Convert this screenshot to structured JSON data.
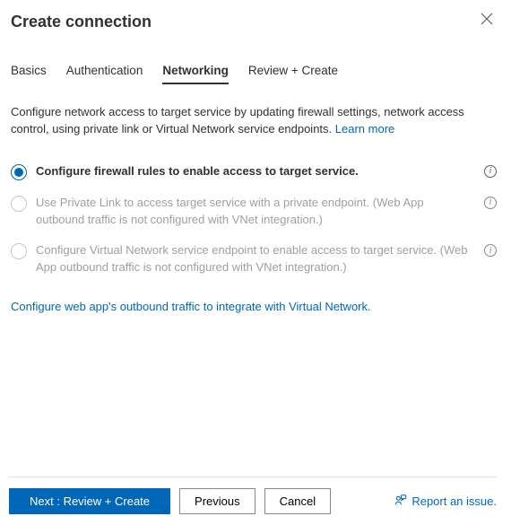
{
  "header": {
    "title": "Create connection"
  },
  "tabs": [
    {
      "label": "Basics",
      "active": false
    },
    {
      "label": "Authentication",
      "active": false
    },
    {
      "label": "Networking",
      "active": true
    },
    {
      "label": "Review + Create",
      "active": false
    }
  ],
  "description": {
    "text": "Configure network access to target service by updating firewall settings, network access control, using private link or Virtual Network service endpoints.",
    "learn_more": "Learn more"
  },
  "options": [
    {
      "label": "Configure firewall rules to enable access to target service.",
      "selected": true,
      "disabled": false,
      "info": true
    },
    {
      "label": "Use Private Link to access target service with a private endpoint. (Web App outbound traffic is not configured with VNet integration.)",
      "selected": false,
      "disabled": true,
      "info": true
    },
    {
      "label": "Configure Virtual Network service endpoint to enable access to target service. (Web App outbound traffic is not configured with VNet integration.)",
      "selected": false,
      "disabled": true,
      "info": true
    }
  ],
  "outbound_link": "Configure web app's outbound traffic to integrate with Virtual Network.",
  "footer": {
    "primary": "Next : Review + Create",
    "previous": "Previous",
    "cancel": "Cancel",
    "report": "Report an issue."
  }
}
